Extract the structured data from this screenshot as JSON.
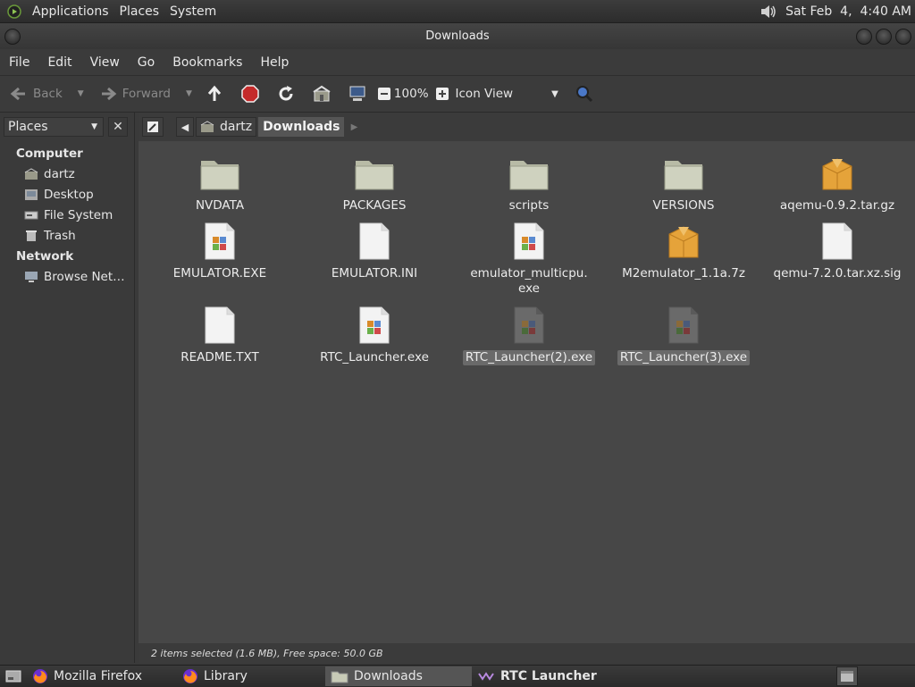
{
  "top_panel": {
    "menus": [
      "Applications",
      "Places",
      "System"
    ],
    "clock": "Sat Feb  4,  4:40 AM",
    "icons": [
      "gnome-foot-icon",
      "volume-icon"
    ]
  },
  "window": {
    "title": "Downloads"
  },
  "menubar": [
    "File",
    "Edit",
    "View",
    "Go",
    "Bookmarks",
    "Help"
  ],
  "toolbar": {
    "back": "Back",
    "forward": "Forward",
    "zoom": "100%",
    "view_mode": "Icon View",
    "icons": [
      "back-arrow-icon",
      "forward-arrow-icon",
      "up-arrow-icon",
      "stop-icon",
      "reload-icon",
      "home-icon",
      "computer-icon",
      "zoom-out-icon",
      "zoom-in-icon",
      "search-icon"
    ]
  },
  "sidebar": {
    "selector": "Places",
    "sections": [
      {
        "title": "Computer",
        "items": [
          "dartz",
          "Desktop",
          "File System",
          "Trash"
        ]
      },
      {
        "title": "Network",
        "items": [
          "Browse Net…"
        ]
      }
    ]
  },
  "location": {
    "crumbs": [
      "dartz",
      "Downloads"
    ]
  },
  "files": [
    {
      "name": "NVDATA",
      "type": "folder",
      "selected": false
    },
    {
      "name": "PACKAGES",
      "type": "folder",
      "selected": false
    },
    {
      "name": "scripts",
      "type": "folder",
      "selected": false
    },
    {
      "name": "VERSIONS",
      "type": "folder",
      "selected": false
    },
    {
      "name": "aqemu-0.9.2.tar.gz",
      "type": "archive",
      "selected": false
    },
    {
      "name": "EMULATOR.EXE",
      "type": "exe",
      "selected": false
    },
    {
      "name": "EMULATOR.INI",
      "type": "text",
      "selected": false
    },
    {
      "name": "emulator_multicpu.\nexe",
      "type": "exe",
      "selected": false
    },
    {
      "name": "M2emulator_1.1a.7z",
      "type": "archive",
      "selected": false
    },
    {
      "name": "qemu-7.2.0.tar.xz.sig",
      "type": "text",
      "selected": false
    },
    {
      "name": "README.TXT",
      "type": "text",
      "selected": false
    },
    {
      "name": "RTC_Launcher.exe",
      "type": "exe",
      "selected": false
    },
    {
      "name": "RTC_Launcher(2).exe",
      "type": "exe",
      "selected": true
    },
    {
      "name": "RTC_Launcher(3).exe",
      "type": "exe",
      "selected": true
    }
  ],
  "status": "2 items selected (1.6 MB), Free space: 50.0 GB",
  "taskbar": {
    "tasks": [
      {
        "label": "Mozilla Firefox",
        "icon": "firefox-icon"
      },
      {
        "label": "Library",
        "icon": "firefox-icon"
      },
      {
        "label": "Downloads",
        "icon": "folder-icon"
      },
      {
        "label": "RTC Launcher",
        "icon": "wine-icon"
      }
    ]
  },
  "colors": {
    "accent_select": "#6a6a6a",
    "folder": "#c8cbb7",
    "archive": "#e1a23a",
    "stop": "#c42a2a",
    "search": "#4a78c8"
  }
}
